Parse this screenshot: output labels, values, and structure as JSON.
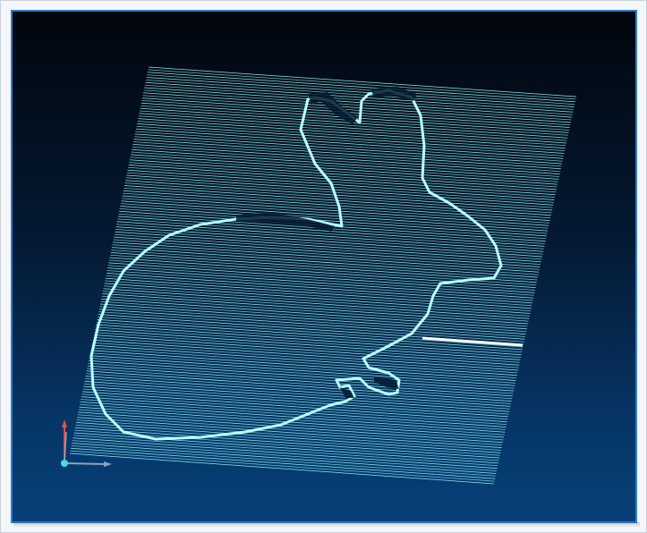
{
  "viewport": {
    "background_top": "#02060d",
    "background_bottom": "#074179",
    "border_color": "#2b7fd6"
  },
  "toolpath": {
    "line_color": "#8ff5f5",
    "feature_color": "#b8ffff",
    "highlight_color": "#ffffff"
  },
  "axes": {
    "x_color": "#8fa3b8",
    "y_color": "#8fa3b8",
    "z_color": "#d9534f",
    "origin_color": "#3ee0e0",
    "icons": [
      "axis-triad-icon",
      "origin-marker-icon"
    ]
  }
}
